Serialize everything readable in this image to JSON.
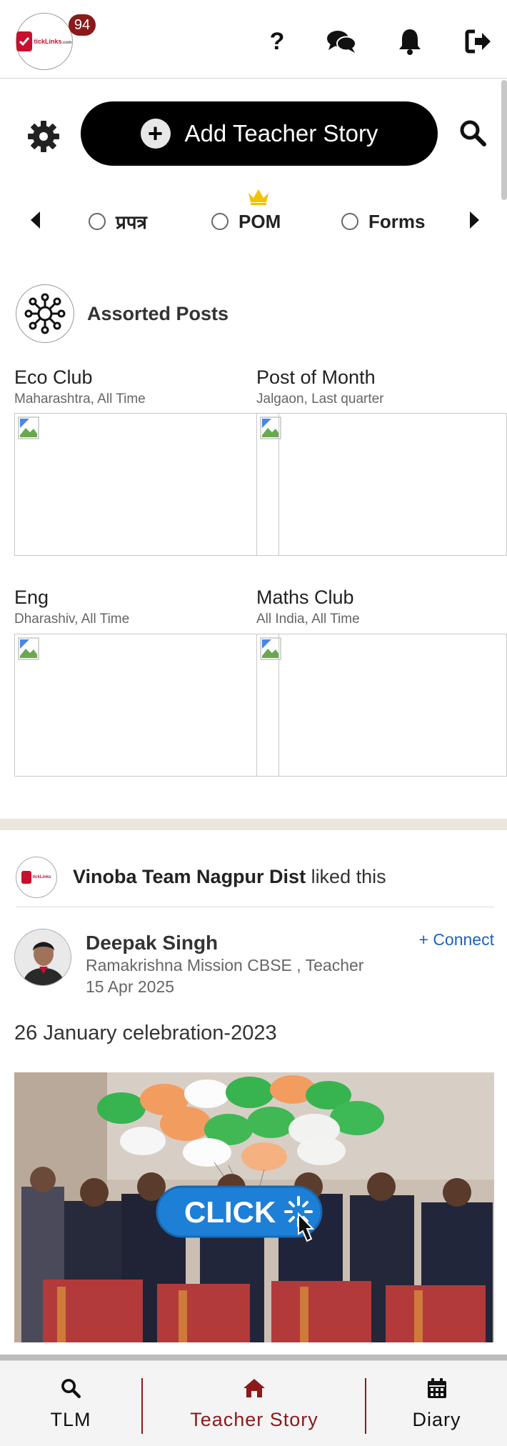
{
  "header": {
    "logo_text": "tickLinks",
    "logo_suffix": ".com",
    "notification_count": "94",
    "icons": [
      "help-icon",
      "chat-icon",
      "bell-icon",
      "logout-icon"
    ],
    "help_glyph": "?"
  },
  "actions": {
    "settings_icon": "gear-icon",
    "add_story_label": "Add Teacher Story",
    "add_story_glyph": "+",
    "search_icon": "search-icon"
  },
  "categories": {
    "tabs": [
      {
        "label": "प्रपत्र",
        "selected": false
      },
      {
        "label": "POM",
        "selected": false,
        "badge": "crown-icon"
      },
      {
        "label": "Forms",
        "selected": false
      }
    ]
  },
  "assorted": {
    "title": "Assorted Posts",
    "cards": [
      {
        "title": "Eco Club",
        "subtitle": "Maharashtra, All Time"
      },
      {
        "title": "Post of Month",
        "subtitle": "Jalgaon, Last quarter"
      },
      {
        "title": "Eng",
        "subtitle": "Dharashiv, All Time"
      },
      {
        "title": "Maths Club",
        "subtitle": "All India, All Time"
      }
    ]
  },
  "feed": {
    "liked_by": "Vinoba Team Nagpur Dist",
    "liked_suffix": " liked this",
    "author": {
      "name": "Deepak Singh",
      "role": "Ramakrishna Mission CBSE , Teacher",
      "date": "15 Apr 2025",
      "connect_label": "+ Connect"
    },
    "post_title": "26 January celebration-2023",
    "image_overlay_label": "CLICK"
  },
  "bottom_nav": {
    "items": [
      {
        "label": "TLM",
        "icon": "search-icon",
        "active": false
      },
      {
        "label": "Teacher Story",
        "icon": "home-icon",
        "active": true
      },
      {
        "label": "Diary",
        "icon": "calendar-icon",
        "active": false
      }
    ]
  },
  "colors": {
    "brand_red": "#8b1a1a",
    "link_blue": "#1a62c2",
    "primary_button": "#000000",
    "divider": "#ebe6dc"
  }
}
